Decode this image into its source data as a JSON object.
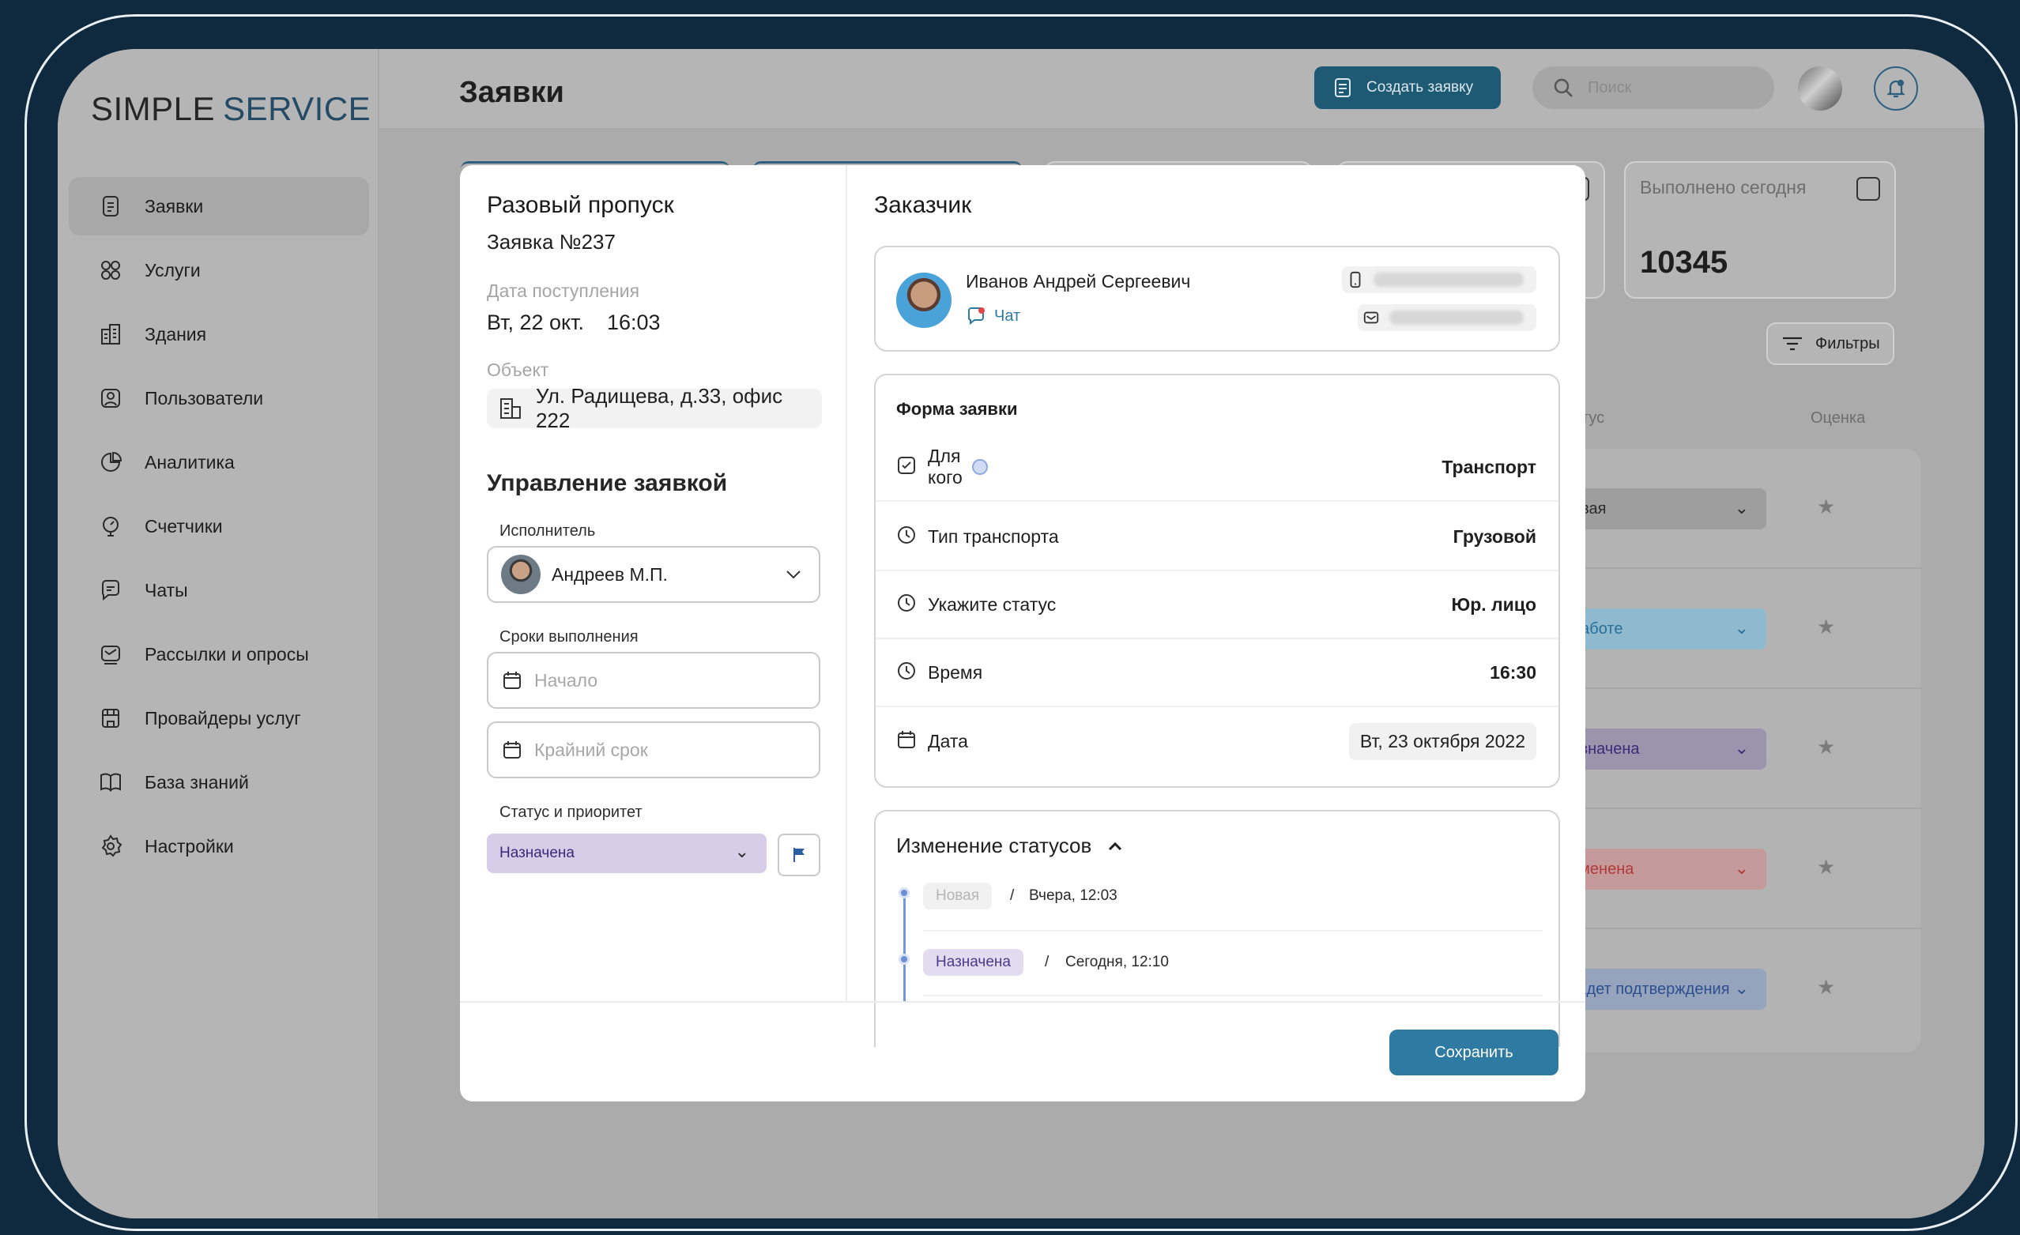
{
  "brand": {
    "part1": "SIMPLE",
    "part2": "SERVICE"
  },
  "header": {
    "title": "Заявки",
    "create_label": "Создать заявку",
    "search_placeholder": "Поиск"
  },
  "sidebar": {
    "items": [
      {
        "label": "Заявки",
        "icon": "document-icon",
        "active": true
      },
      {
        "label": "Услуги",
        "icon": "grid-icon"
      },
      {
        "label": "Здания",
        "icon": "building-icon"
      },
      {
        "label": "Пользователи",
        "icon": "user-icon"
      },
      {
        "label": "Аналитика",
        "icon": "pie-chart-icon"
      },
      {
        "label": "Счетчики",
        "icon": "meter-icon"
      },
      {
        "label": "Чаты",
        "icon": "chat-icon"
      },
      {
        "label": "Рассылки и опросы",
        "icon": "mail-icon"
      },
      {
        "label": "Провайдеры услуг",
        "icon": "store-icon"
      },
      {
        "label": "База знаний",
        "icon": "book-icon"
      },
      {
        "label": "Настройки",
        "icon": "gear-icon"
      }
    ]
  },
  "stats": {
    "done_today_label": "Выполнено сегодня",
    "done_today_value": "10345"
  },
  "filters_label": "Фильтры",
  "table": {
    "col_status": "тус",
    "col_rating": "Оценка",
    "rows": [
      {
        "status": "овая",
        "bg": "#9e9e9e",
        "fg": "#2a2a2a"
      },
      {
        "status": "работе",
        "bg": "#8eb9cf",
        "fg": "#2b6f97"
      },
      {
        "status": "азначена",
        "bg": "#9c94ad",
        "fg": "#3c2a78"
      },
      {
        "status": "тменена",
        "bg": "#c49a9a",
        "fg": "#b23a3a"
      },
      {
        "status": "Ждет подтверждения",
        "bg": "#96a3bd",
        "fg": "#2b4f8f"
      }
    ]
  },
  "modal": {
    "title": "Разовый пропуск",
    "number": "Заявка №237",
    "received_label": "Дата поступления",
    "received_date": "Вт, 22 окт.",
    "received_time": "16:03",
    "object_label": "Объект",
    "object_value": "Ул. Радищева, д.33, офис 222",
    "manage_title": "Управление заявкой",
    "executor_label": "Исполнитель",
    "executor_value": "Андреев М.П.",
    "deadline_label": "Сроки выполнения",
    "start_placeholder": "Начало",
    "end_placeholder": "Крайний срок",
    "status_label": "Статус и приоритет",
    "status_value": "Назначена",
    "customer_title": "Заказчик",
    "customer_name": "Иванов Андрей Сергеевич",
    "chat_label": "Чат",
    "form_title": "Форма заявки",
    "form_rows": [
      {
        "label": "Для кого",
        "value": "Транспорт",
        "icon": "checkbox-icon",
        "info": true
      },
      {
        "label": "Тип транспорта",
        "value": "Грузовой",
        "icon": "clock-icon"
      },
      {
        "label": "Укажите статус",
        "value": "Юр. лицо",
        "icon": "clock-icon"
      },
      {
        "label": "Время",
        "value": "16:30",
        "icon": "clock-icon"
      },
      {
        "label": "Дата",
        "value": "Вт, 23 октября 2022",
        "icon": "calendar-icon"
      }
    ],
    "history_title": "Изменение статусов",
    "history": [
      {
        "status": "Новая",
        "sep": "/",
        "time": "Вчера, 12:03"
      },
      {
        "status": "Назначена",
        "sep": "/",
        "time": "Сегодня, 12:10"
      }
    ],
    "save_label": "Сохранить"
  }
}
